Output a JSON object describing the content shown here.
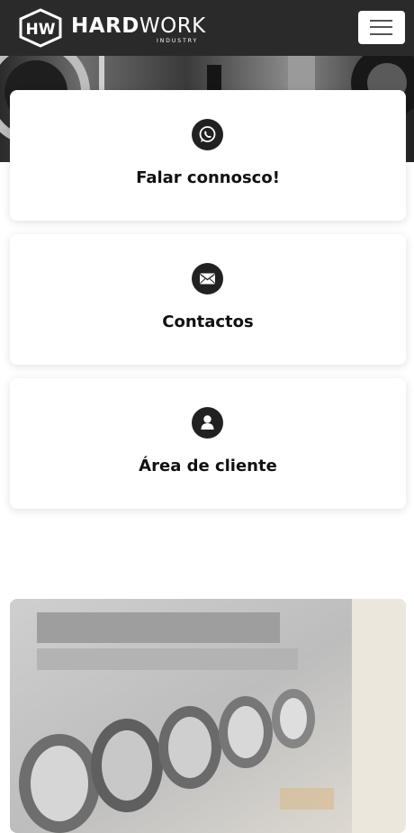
{
  "header": {
    "brand_bold": "HARD",
    "brand_light": "WORK",
    "brand_sub": "INDUSTRY",
    "logo_mark": "HW",
    "menu_icon": "hamburger-menu-icon"
  },
  "cards": [
    {
      "title": "Falar connosco!",
      "icon": "whatsapp-icon"
    },
    {
      "title": "Contactos",
      "icon": "envelope-icon"
    },
    {
      "title": "Área de cliente",
      "icon": "user-icon"
    }
  ],
  "colors": {
    "header_bg": "#2a2a2a",
    "icon_bg": "#212121",
    "title_text": "#111111"
  }
}
